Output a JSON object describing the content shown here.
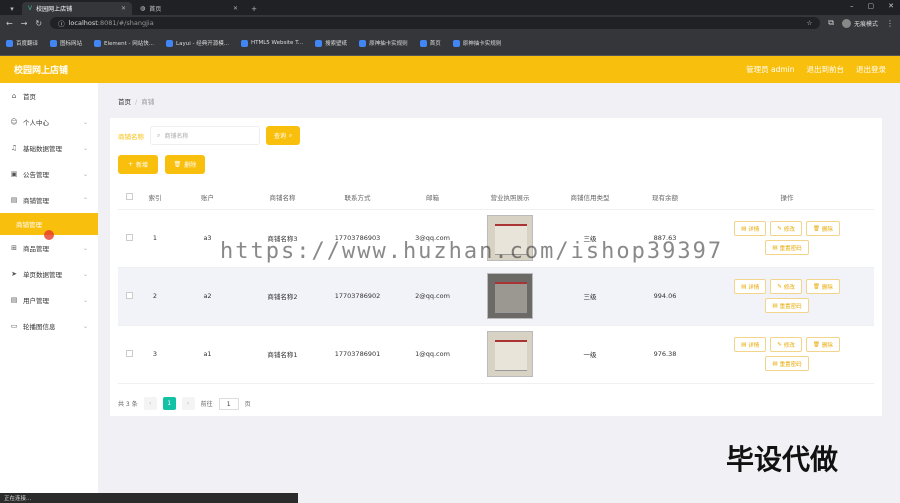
{
  "browser": {
    "tabs": [
      {
        "label": "校园网上店铺",
        "active": true
      },
      {
        "label": "首页",
        "active": false
      }
    ],
    "new_tab": "+",
    "window_controls": [
      "–",
      "▢",
      "✕"
    ],
    "address": {
      "host": "localhost",
      "rest": ":8081/#/shangjia"
    },
    "profile_label": "无痕模式",
    "bookmarks": [
      "百度翻译",
      "图标网站",
      "Element - 网站快...",
      "Layui - 经典开源模...",
      "HTML5 Website T...",
      "搜索壁纸",
      "原神抽卡实规则",
      "首页",
      "原神抽卡实规则"
    ],
    "status_text": "正在连接..."
  },
  "header": {
    "brand": "校园网上店铺",
    "links": [
      "管理员 admin",
      "退出到前台",
      "退出登录"
    ]
  },
  "sidebar": {
    "items": [
      {
        "label": "首页",
        "icon": "home-icon",
        "glyph": "⌂",
        "arrow": ""
      },
      {
        "label": "个人中心",
        "icon": "user-icon",
        "glyph": "☺",
        "arrow": "⌄"
      },
      {
        "label": "基础数据管理",
        "icon": "bell-icon",
        "glyph": "♫",
        "arrow": "⌄"
      },
      {
        "label": "公告管理",
        "icon": "calendar-icon",
        "glyph": "▣",
        "arrow": "⌄"
      },
      {
        "label": "商铺管理",
        "icon": "doc-icon",
        "glyph": "▤",
        "arrow": "⌃"
      }
    ],
    "active_sub": "商铺管理",
    "items_after": [
      {
        "label": "商品管理",
        "icon": "grid-icon",
        "glyph": "⊞",
        "arrow": "⌄"
      },
      {
        "label": "单页数据管理",
        "icon": "send-icon",
        "glyph": "➤",
        "arrow": "⌄"
      },
      {
        "label": "用户管理",
        "icon": "doc-icon",
        "glyph": "▤",
        "arrow": "⌄"
      },
      {
        "label": "轮播图信息",
        "icon": "chat-icon",
        "glyph": "▭",
        "arrow": "⌄"
      }
    ]
  },
  "breadcrumb": {
    "home": "首页",
    "sep": "/",
    "current": "商铺"
  },
  "search": {
    "label": "商铺名称",
    "placeholder": "商铺名称",
    "button": "查询"
  },
  "actions": {
    "add": "新增",
    "delete": "删除"
  },
  "table": {
    "headers": [
      "索引",
      "账户",
      "商铺名称",
      "联系方式",
      "邮箱",
      "营业执照展示",
      "商铺信用类型",
      "现有余额",
      "操作"
    ],
    "rows": [
      {
        "index": "1",
        "account": "a3",
        "name": "商铺名称3",
        "phone": "17703786903",
        "email": "3@qq.com",
        "credit": "三级",
        "balance": "887.63"
      },
      {
        "index": "2",
        "account": "a2",
        "name": "商铺名称2",
        "phone": "17703786902",
        "email": "2@qq.com",
        "credit": "三级",
        "balance": "994.06"
      },
      {
        "index": "3",
        "account": "a1",
        "name": "商铺名称1",
        "phone": "17703786901",
        "email": "1@qq.com",
        "credit": "一级",
        "balance": "976.38"
      }
    ],
    "row_ops": {
      "detail": "详情",
      "edit": "修改",
      "delete": "删除",
      "reset": "重置密码"
    }
  },
  "pagination": {
    "total": "共 3 条",
    "prev": "‹",
    "page": "1",
    "next": "›",
    "goto": "前往",
    "page_input": "1",
    "unit": "页"
  },
  "overlay": {
    "watermark": "https://www.huzhan.com/ishop39397",
    "stamp": "毕设代做"
  }
}
